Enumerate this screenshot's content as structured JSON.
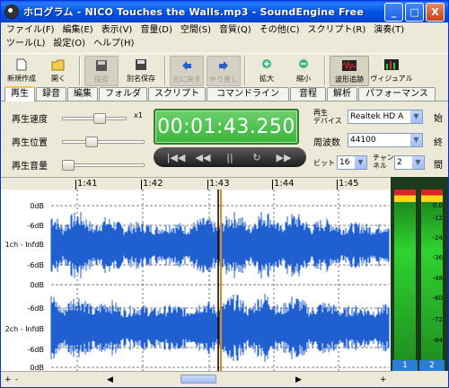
{
  "window": {
    "title": "ホログラム - NICO Touches the Walls.mp3 - SoundEngine Free",
    "minimize_label": "_",
    "maximize_label": "□",
    "close_label": "X"
  },
  "menu": [
    "ファイル(F)",
    "編集(E)",
    "表示(V)",
    "音量(D)",
    "空間(S)",
    "音質(Q)",
    "その他(C)",
    "スクリプト(R)",
    "演奏(T)",
    "ツール(L)",
    "設定(O)",
    "ヘルプ(H)"
  ],
  "toolbar": {
    "new_label": "新規作成",
    "open_label": "開く",
    "save_label": "保存",
    "saveas_label": "別名保存",
    "undo_label": "元に戻す",
    "redo_label": "やり直し",
    "zoomin_label": "拡大",
    "zoomout_label": "縮小",
    "waveform_label": "波形追跡",
    "visual_label": "ヴィジュアル",
    "icons": {
      "new": "new-file-icon",
      "open": "folder-icon",
      "save": "floppy-icon",
      "saveas": "save-as-icon",
      "undo": "undo-icon",
      "redo": "redo-icon",
      "zoomin": "zoom-in-icon",
      "zoomout": "zoom-out-icon",
      "waveform": "waveform-follow-icon",
      "visual": "visual-icon"
    }
  },
  "tabs": [
    "再生",
    "録音",
    "編集",
    "フォルダ",
    "スクリプト",
    "コマンドライン",
    "音程",
    "解析",
    "パフォーマンス"
  ],
  "playback": {
    "speed_label": "再生速度",
    "speed_suffix": "x1",
    "position_label": "再生位置",
    "volume_label": "再生音量",
    "time": "00:01:43.250",
    "device_label_1": "再生",
    "device_label_2": "デバイス",
    "device_value": "Realtek HD A",
    "freq_label": "周波数",
    "freq_value": "44100",
    "bit_label": "ビット",
    "bit_value": "16",
    "channel_label_1": "チャン",
    "channel_label_2": "ネル",
    "channel_value": "2",
    "side_start": "始",
    "side_end": "終",
    "side_interval": "間",
    "transport": {
      "rewind_label": "|◀◀",
      "back_label": "◀◀",
      "pause_label": "||",
      "loop_label": "↻",
      "forward_label": "▶▶"
    }
  },
  "ruler": {
    "ticks": [
      "1:41",
      "1:42",
      "1:43",
      "1:44",
      "1:45"
    ]
  },
  "db_labels": {
    "ch1_top": "0dB",
    "ch1_upper": "-6dB",
    "ch1_mid": "1ch - InfdB",
    "ch1_lower": "-6dB",
    "ch1_bottom": "0dB",
    "ch2_top": "-6dB",
    "ch2_mid": "2ch - InfdB",
    "ch2_lower": "-6dB",
    "ch2_bottom": "0dB"
  },
  "meters": {
    "ch1_label": "1",
    "ch2_label": "2",
    "scale": [
      "0.0",
      "-12",
      "-24",
      "-36",
      "-48",
      "-60",
      "-72",
      "-84"
    ]
  },
  "scrollbar": {
    "plus_left": "+",
    "minus_left": "-",
    "left_arrow": "◀",
    "right_arrow": "▶",
    "plus_right": "+"
  },
  "colors": {
    "waveform": "#1f5fd0",
    "cursor": "#e08a1e",
    "lcd": "#3bb53b"
  }
}
